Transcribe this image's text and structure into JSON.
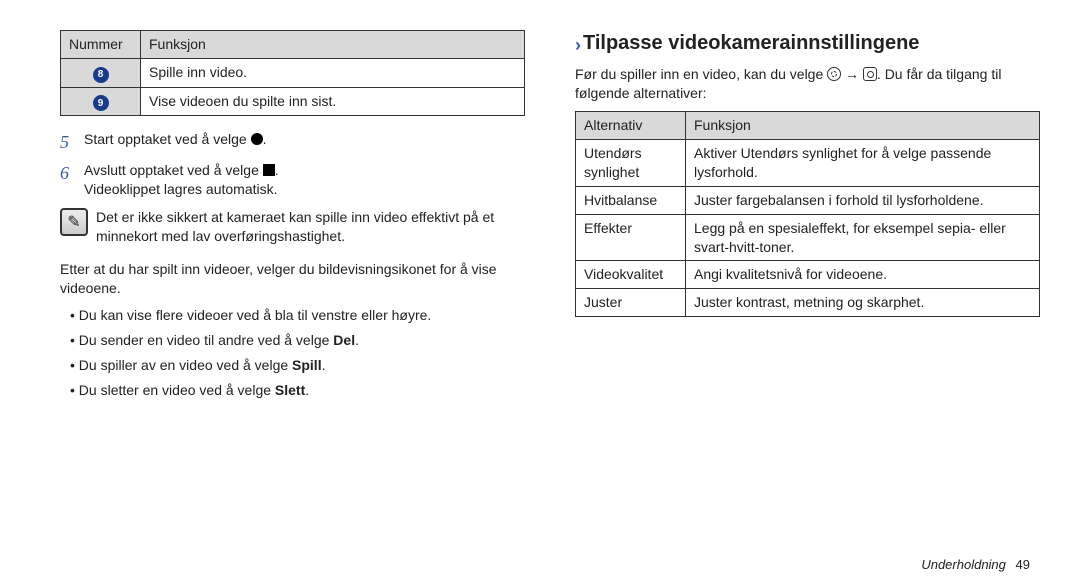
{
  "left": {
    "table": {
      "headers": [
        "Nummer",
        "Funksjon"
      ],
      "rows": [
        {
          "num": "8",
          "func": "Spille inn video."
        },
        {
          "num": "9",
          "func": "Vise videoen du spilte inn sist."
        }
      ]
    },
    "step5": {
      "num": "5",
      "pre": "Start opptaket ved å velge ",
      "post": "."
    },
    "step6": {
      "num": "6",
      "pre": "Avslutt opptaket ved å velge ",
      "post": ".",
      "line2": "Videoklippet lagres automatisk."
    },
    "note": "Det er ikke sikkert at kameraet kan spille inn video effektivt på et minnekort med lav overføringshastighet.",
    "afterNote": "Etter at du har spilt inn videoer, velger du bildevisningsikonet for å vise videoene.",
    "bullets": [
      {
        "text": "Du kan vise flere videoer ved å bla til venstre eller høyre."
      },
      {
        "text": "Du sender en video til andre ved å velge ",
        "bold": "Del",
        "tail": "."
      },
      {
        "text": "Du spiller av en video ved å velge ",
        "bold": "Spill",
        "tail": "."
      },
      {
        "text": "Du sletter en video ved å velge ",
        "bold": "Slett",
        "tail": "."
      }
    ]
  },
  "right": {
    "heading": "Tilpasse videokamerainnstillingene",
    "intro_pre": "Før du spiller inn en video, kan du velge ",
    "intro_mid": " → ",
    "intro_post": ". Du får da tilgang til følgende alternativer:",
    "table": {
      "headers": [
        "Alternativ",
        "Funksjon"
      ],
      "rows": [
        {
          "a": "Utendørs synlighet",
          "f": "Aktiver Utendørs synlighet for å velge passende lysforhold."
        },
        {
          "a": "Hvitbalanse",
          "f": "Juster fargebalansen i forhold til lysforholdene."
        },
        {
          "a": "Effekter",
          "f": "Legg på en spesialeffekt, for eksempel sepia- eller svart-hvitt-toner."
        },
        {
          "a": "Videokvalitet",
          "f": "Angi kvalitetsnivå for videoene."
        },
        {
          "a": "Juster",
          "f": "Juster kontrast, metning og skarphet."
        }
      ]
    }
  },
  "footer": {
    "section": "Underholdning",
    "page": "49"
  }
}
